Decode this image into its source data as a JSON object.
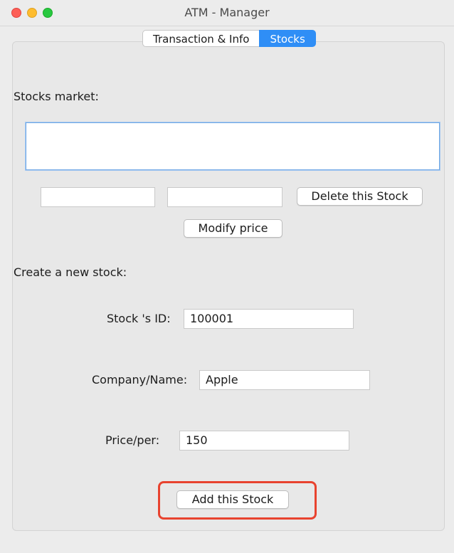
{
  "window": {
    "title": "ATM - Manager"
  },
  "tabs": [
    {
      "label": "Transaction & Info",
      "active": false
    },
    {
      "label": "Stocks",
      "active": true
    }
  ],
  "market": {
    "heading": "Stocks market:",
    "list_text": "",
    "field1_value": "",
    "field2_value": "",
    "delete_label": "Delete this Stock",
    "modify_label": "Modify price"
  },
  "create": {
    "heading": "Create a new stock:",
    "id_label": "Stock 's ID:",
    "id_value": "100001",
    "company_label": "Company/Name:",
    "company_value": "Apple",
    "price_label": "Price/per:",
    "price_value": "150",
    "add_label": "Add this Stock"
  },
  "colors": {
    "accent": "#2f8ef6",
    "highlight": "#e8432f"
  }
}
